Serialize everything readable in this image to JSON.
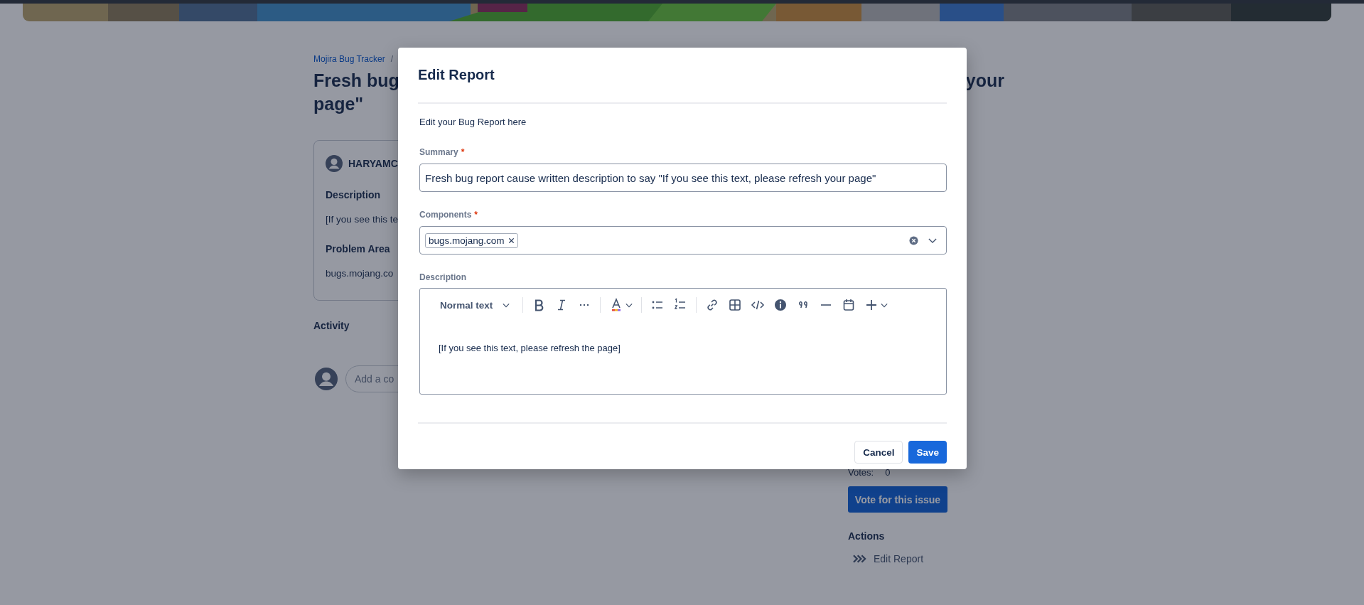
{
  "background_page": {
    "breadcrumb": {
      "link": "Mojira Bug Tracker",
      "separator": "/"
    },
    "title_line1_start": "Fresh bug",
    "title_line1_end": "your",
    "title_line2": "page\"",
    "card": {
      "author": "HARYAMC",
      "description_label": "Description",
      "description_text": "[If you see this te",
      "problem_area_label": "Problem Area",
      "problem_area_text": "bugs.mojang.co"
    },
    "activity_label": "Activity",
    "comment_placeholder": "Add a co",
    "sidebar": {
      "votes_label": "Votes:",
      "votes_count": "0",
      "vote_button": "Vote for this issue",
      "actions_label": "Actions",
      "actions": [
        {
          "label": "Edit Report"
        }
      ]
    }
  },
  "modal": {
    "title": "Edit Report",
    "intro": "Edit your Bug Report here",
    "summary": {
      "label": "Summary",
      "required_mark": "*",
      "value": "Fresh bug report cause written description to say \"If you see this text, please refresh your page\""
    },
    "components": {
      "label": "Components",
      "required_mark": "*",
      "chips": [
        "bugs.mojang.com"
      ]
    },
    "description": {
      "label": "Description",
      "text_style": "Normal text",
      "content": "[If you see this text, please refresh the page]"
    },
    "buttons": [
      {
        "label": "Cancel",
        "kind": "secondary"
      },
      {
        "label": "Save",
        "kind": "primary"
      }
    ]
  }
}
